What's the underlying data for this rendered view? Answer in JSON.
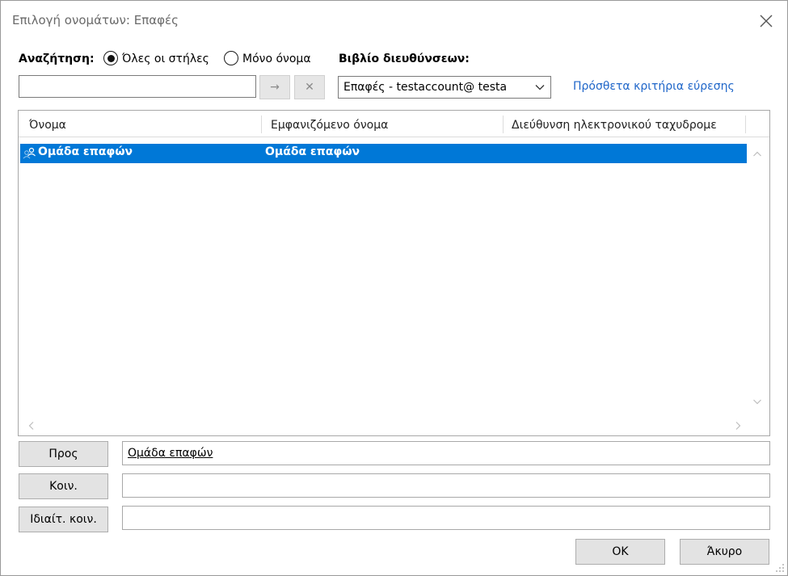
{
  "window": {
    "title": "Επιλογή ονομάτων: Επαφές"
  },
  "search": {
    "label": "Αναζήτηση:",
    "options": [
      {
        "label": "Όλες οι στήλες",
        "selected": true
      },
      {
        "label": "Μόνο όνομα",
        "selected": false
      }
    ],
    "input_value": "",
    "go_icon": "arrow-right-icon",
    "go_symbol": "→",
    "clear_icon": "close-icon",
    "clear_symbol": "✕"
  },
  "address_book": {
    "label": "Βιβλίο διευθύνσεων:",
    "selected": "Επαφές - testaccount@ testa"
  },
  "advanced_link": "Πρόσθετα κριτήρια εύρεσης",
  "list": {
    "columns": [
      "Όνομα",
      "Εμφανιζόμενο όνομα",
      "Διεύθυνση ηλεκτρονικού ταχυδρομε"
    ],
    "rows": [
      {
        "icon": "contact-group-icon",
        "name": "Ομάδα επαφών",
        "display_name": "Ομάδα επαφών",
        "email": "",
        "selected": true
      }
    ]
  },
  "recipients": {
    "to": {
      "label": "Προς",
      "value": "Ομάδα επαφών"
    },
    "cc": {
      "label": "Κοιν.",
      "value": ""
    },
    "bcc": {
      "label": "Ιδιαίτ. κοιν.",
      "value": ""
    }
  },
  "actions": {
    "ok": "OK",
    "cancel": "Άκυρο"
  },
  "colors": {
    "selection": "#0078d7",
    "link": "#1f66c9",
    "button_face": "#e3e3e3",
    "title_text": "#6a6a6a"
  }
}
